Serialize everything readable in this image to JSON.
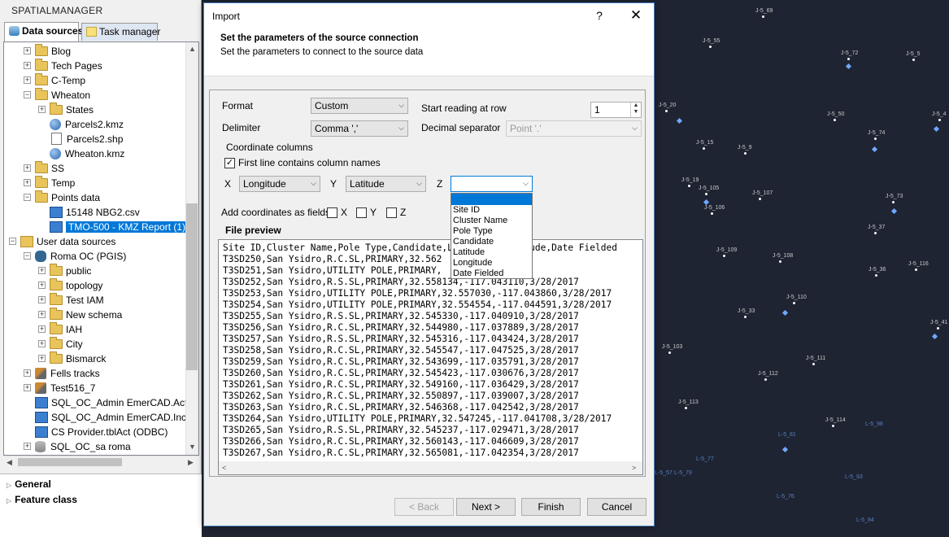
{
  "app": {
    "title": "SPATIALMANAGER"
  },
  "tabs": {
    "data_sources": "Data sources",
    "task_manager": "Task manager"
  },
  "tree": {
    "items": [
      {
        "label": "Blog"
      },
      {
        "label": "Tech Pages"
      },
      {
        "label": "C-Temp"
      },
      {
        "label": "Wheaton"
      },
      {
        "label": "States"
      },
      {
        "label": "Parcels2.kmz"
      },
      {
        "label": "Parcels2.shp"
      },
      {
        "label": "Wheaton.kmz"
      },
      {
        "label": "SS"
      },
      {
        "label": "Temp"
      },
      {
        "label": "Points data"
      },
      {
        "label": "15148 NBG2.csv"
      },
      {
        "label": "TMO-500 - KMZ Report (1)"
      },
      {
        "label": "User data sources"
      },
      {
        "label": "Roma OC (PGIS)"
      },
      {
        "label": "public"
      },
      {
        "label": "topology"
      },
      {
        "label": "Test IAM"
      },
      {
        "label": "New schema"
      },
      {
        "label": "IAH"
      },
      {
        "label": "City"
      },
      {
        "label": "Bismarck"
      },
      {
        "label": "Fells tracks"
      },
      {
        "label": "Test516_7"
      },
      {
        "label": "SQL_OC_Admin EmerCAD.ActX"
      },
      {
        "label": "SQL_OC_Admin EmerCAD.Inci"
      },
      {
        "label": "CS Provider.tblAct (ODBC)"
      },
      {
        "label": "SQL_OC_sa roma"
      }
    ]
  },
  "properties": {
    "general": "General",
    "feature_class": "Feature class"
  },
  "dialog": {
    "title": "Import",
    "help": "?",
    "close": "✕",
    "header_title": "Set the parameters of the source connection",
    "header_subtitle": "Set the parameters to connect to the source data",
    "format_label": "Format",
    "format_value": "Custom",
    "start_label": "Start reading at row",
    "start_value": "1",
    "delimiter_label": "Delimiter",
    "delimiter_value": "Comma ','",
    "decimal_label": "Decimal separator",
    "decimal_value": "Point '.'",
    "coord_group": "Coordinate columns",
    "first_line_label": "First line contains column names",
    "first_line_checked": true,
    "x_label": "X",
    "x_value": "Longitude",
    "y_label": "Y",
    "y_value": "Latitude",
    "z_label": "Z",
    "z_value": "",
    "z_options": [
      "",
      "Site ID",
      "Cluster Name",
      "Pole Type",
      "Candidate",
      "Latitude",
      "Longitude",
      "Date Fielded"
    ],
    "add_coords_label": "Add coordinates as fields",
    "add_x": "X",
    "add_y": "Y",
    "add_z": "Z",
    "preview_label": "File preview",
    "preview_lines": [
      "Site ID,Cluster Name,Pole Type,Candidate,Latitude,Longitude,Date Fielded",
      "T3SD250,San Ysidro,R.C.SL,PRIMARY,32.562",
      "T3SD251,San Ysidro,UTILITY POLE,PRIMARY,",
      "T3SD252,San Ysidro,R.S.SL,PRIMARY,32.558134,-117.043110,3/28/2017",
      "T3SD253,San Ysidro,UTILITY POLE,PRIMARY,32.557030,-117.043860,3/28/2017",
      "T3SD254,San Ysidro,UTILITY POLE,PRIMARY,32.554554,-117.044591,3/28/2017",
      "T3SD255,San Ysidro,R.S.SL,PRIMARY,32.545330,-117.040910,3/28/2017",
      "T3SD256,San Ysidro,R.C.SL,PRIMARY,32.544980,-117.037889,3/28/2017",
      "T3SD257,San Ysidro,R.S.SL,PRIMARY,32.545316,-117.043424,3/28/2017",
      "T3SD258,San Ysidro,R.C.SL,PRIMARY,32.545547,-117.047525,3/28/2017",
      "T3SD259,San Ysidro,R.C.SL,PRIMARY,32.543699,-117.035791,3/28/2017",
      "T3SD260,San Ysidro,R.C.SL,PRIMARY,32.545423,-117.030676,3/28/2017",
      "T3SD261,San Ysidro,R.C.SL,PRIMARY,32.549160,-117.036429,3/28/2017",
      "T3SD262,San Ysidro,R.C.SL,PRIMARY,32.550897,-117.039007,3/28/2017",
      "T3SD263,San Ysidro,R.C.SL,PRIMARY,32.546368,-117.042542,3/28/2017",
      "T3SD264,San Ysidro,UTILITY POLE,PRIMARY,32.547245,-117.041708,3/28/2017",
      "T3SD265,San Ysidro,R.S.SL,PRIMARY,32.545237,-117.029471,3/28/2017",
      "T3SD266,San Ysidro,R.C.SL,PRIMARY,32.560143,-117.046609,3/28/2017",
      "T3SD267,San Ysidro,R.C.SL,PRIMARY,32.565081,-117.042354,3/28/2017"
    ],
    "preview_line1_tail": "3,3/28/2017",
    "preview_line2_tail": "32.562",
    "buttons": {
      "back": "< Back",
      "next": "Next >",
      "finish": "Finish",
      "cancel": "Cancel"
    }
  },
  "map": {
    "labels": [
      "J-5_69",
      "J-5_55",
      "J-5_72",
      "J-5_5",
      "J-5_20",
      "J-5_50",
      "J-5_74",
      "J-5_15",
      "J-5_9",
      "J-5_19",
      "J-5_105",
      "J-5_107",
      "J-5_73",
      "J-5_106",
      "J-5_37",
      "J-5_109",
      "J-5_108",
      "J-5_36",
      "J-5_116",
      "J-5_110",
      "J-5_103",
      "J-5_111",
      "J-5_112",
      "J-5_113",
      "J-5_114",
      "J-5_33",
      "J-5_41",
      "J-5_4"
    ],
    "blue_labels": [
      "L-5_98",
      "L-5_81",
      "L-5_77",
      "L-5_57",
      "L-5_79",
      "L-5_93",
      "L-5_76",
      "L-5_84"
    ]
  }
}
